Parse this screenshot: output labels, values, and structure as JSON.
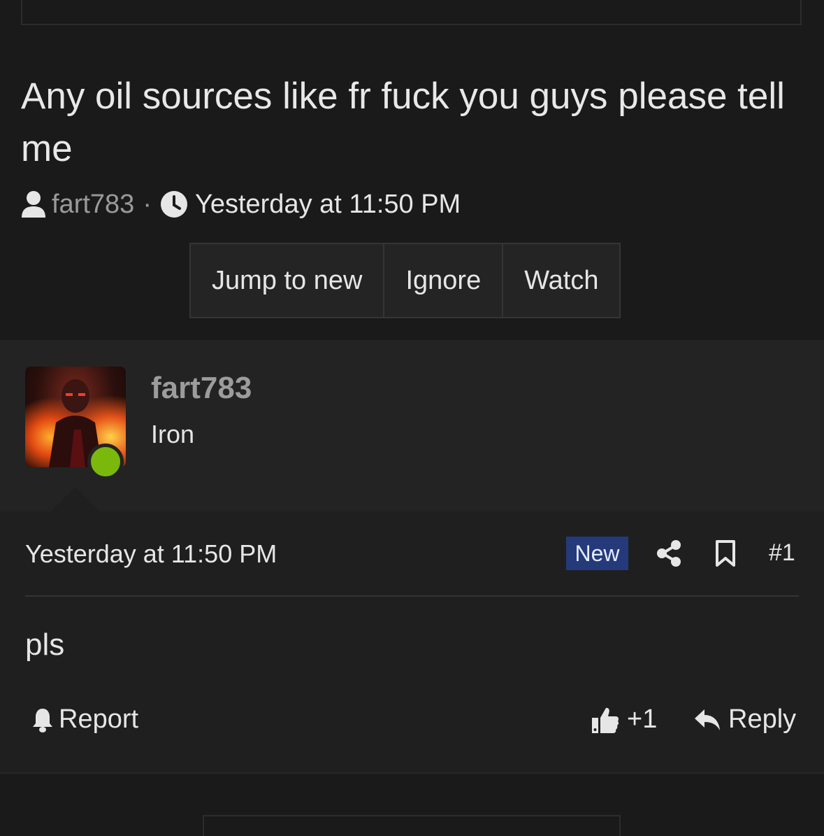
{
  "thread": {
    "title": "Any oil sources like fr fuck you guys please tell me",
    "author": "fart783",
    "separator": "·",
    "time": "Yesterday at 11:50 PM"
  },
  "actions": {
    "jump_label": "Jump to new",
    "ignore_label": "Ignore",
    "watch_label": "Watch"
  },
  "user": {
    "name": "fart783",
    "title": "Iron",
    "status": "online"
  },
  "post": {
    "date": "Yesterday at 11:50 PM",
    "badge": "New",
    "number": "#1",
    "body": "pls",
    "report_label": "Report",
    "like_label": "+1",
    "reply_label": "Reply"
  },
  "colors": {
    "background": "#1a1a1a",
    "panel": "#232323",
    "badge_bg": "#243a7a",
    "online": "#7bb80c"
  }
}
